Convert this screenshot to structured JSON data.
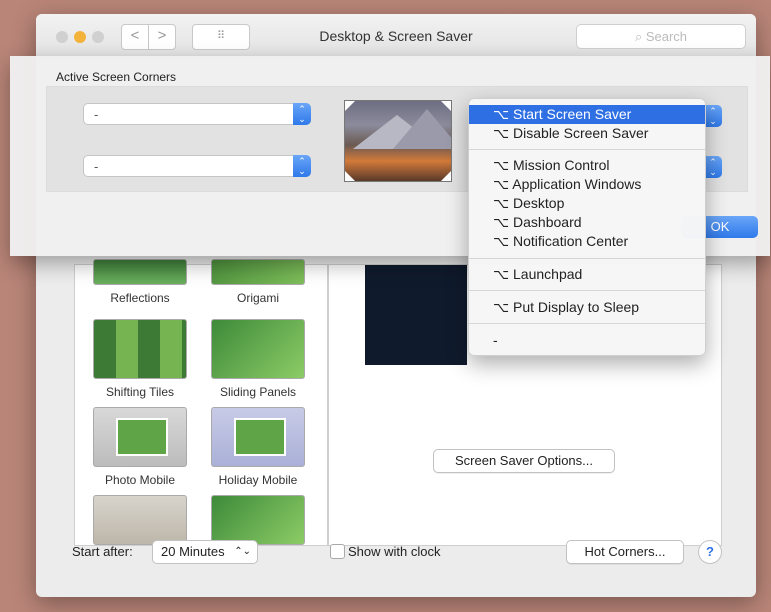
{
  "window": {
    "title": "Desktop & Screen Saver",
    "search_placeholder": "Search",
    "nav_back": "<",
    "nav_forward": ">",
    "grid_glyph": "⠿"
  },
  "sheet": {
    "label": "Active Screen Corners",
    "top_left_value": "-",
    "bottom_left_value": "-",
    "ok_label": "OK"
  },
  "menu": {
    "items": [
      {
        "label": "⌥ Start Screen Saver",
        "selected": true
      },
      {
        "label": "⌥ Disable Screen Saver"
      },
      {
        "label": "⌥ Mission Control"
      },
      {
        "label": "⌥ Application Windows"
      },
      {
        "label": "⌥ Desktop"
      },
      {
        "label": "⌥ Dashboard"
      },
      {
        "label": "⌥ Notification Center"
      },
      {
        "label": "⌥ Launchpad"
      },
      {
        "label": "⌥ Put Display to Sleep"
      },
      {
        "label": "-"
      }
    ]
  },
  "screensavers": [
    {
      "label": "Reflections"
    },
    {
      "label": "Origami"
    },
    {
      "label": "Shifting Tiles"
    },
    {
      "label": "Sliding Panels"
    },
    {
      "label": "Photo Mobile"
    },
    {
      "label": "Holiday Mobile"
    }
  ],
  "preview": {
    "options_button": "Screen Saver Options..."
  },
  "footer": {
    "start_after_label": "Start after:",
    "start_after_value": "20 Minutes",
    "show_clock_label": "Show with clock",
    "hot_corners_button": "Hot Corners...",
    "help": "?"
  },
  "colors": {
    "accent": "#2f6fe4",
    "desktop_bg": "#b98578"
  }
}
